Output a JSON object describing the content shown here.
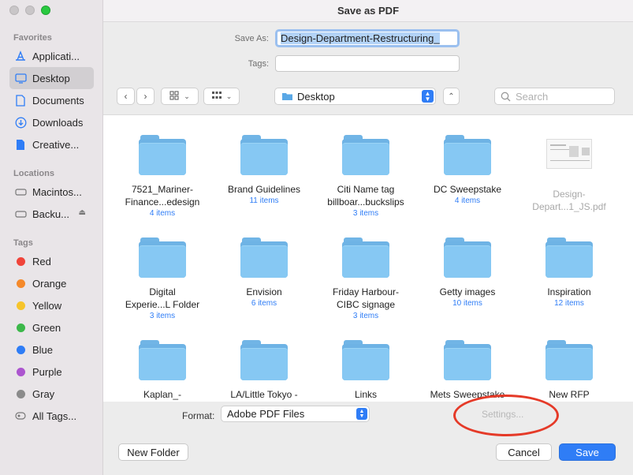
{
  "window": {
    "title": "Save as PDF"
  },
  "sidebar": {
    "favorites_header": "Favorites",
    "favorites": [
      {
        "label": "Applicati...",
        "icon": "applications-icon"
      },
      {
        "label": "Desktop",
        "icon": "desktop-icon"
      },
      {
        "label": "Documents",
        "icon": "document-icon"
      },
      {
        "label": "Downloads",
        "icon": "download-icon"
      },
      {
        "label": "Creative...",
        "icon": "file-icon"
      }
    ],
    "locations_header": "Locations",
    "locations": [
      {
        "label": "Macintos...",
        "icon": "disk-icon"
      },
      {
        "label": "Backu...",
        "icon": "disk-icon"
      }
    ],
    "tags_header": "Tags",
    "tags": [
      {
        "label": "Red",
        "color": "#f0443a"
      },
      {
        "label": "Orange",
        "color": "#f5892a"
      },
      {
        "label": "Yellow",
        "color": "#f6c42b"
      },
      {
        "label": "Green",
        "color": "#3cb84a"
      },
      {
        "label": "Blue",
        "color": "#2f7df6"
      },
      {
        "label": "Purple",
        "color": "#ac55cf"
      },
      {
        "label": "Gray",
        "color": "#8b8b8b"
      }
    ],
    "all_tags": "All Tags..."
  },
  "form": {
    "save_as_label": "Save As:",
    "save_as_value": "Design-Department-Restructuring_",
    "tags_label": "Tags:"
  },
  "toolbar": {
    "location": "Desktop",
    "search_placeholder": "Search"
  },
  "files": [
    {
      "name": "7521_Mariner-\nFinance...edesign",
      "count": "4 items",
      "type": "folder"
    },
    {
      "name": "Brand Guidelines",
      "count": "11 items",
      "type": "folder"
    },
    {
      "name": "Citi Name tag\nbillboar...buckslips",
      "count": "3 items",
      "type": "folder"
    },
    {
      "name": "DC Sweepstake",
      "count": "4 items",
      "type": "folder"
    },
    {
      "name": "Design-\nDepart...1_JS.pdf",
      "count": "",
      "type": "pdf"
    },
    {
      "name": "Digital\nExperie...L Folder",
      "count": "3 items",
      "type": "folder"
    },
    {
      "name": "Envision",
      "count": "6 items",
      "type": "folder"
    },
    {
      "name": "Friday Harbour-\nCIBC signage",
      "count": "3 items",
      "type": "folder"
    },
    {
      "name": "Getty images",
      "count": "10 items",
      "type": "folder"
    },
    {
      "name": "Inspiration",
      "count": "12 items",
      "type": "folder"
    },
    {
      "name": "Kaplan_-",
      "count": "",
      "type": "folder"
    },
    {
      "name": "LA/Little Tokyo -",
      "count": "",
      "type": "folder"
    },
    {
      "name": "Links",
      "count": "",
      "type": "folder"
    },
    {
      "name": "Mets Sweepstake",
      "count": "",
      "type": "folder"
    },
    {
      "name": "New RFP",
      "count": "",
      "type": "folder"
    }
  ],
  "format": {
    "label": "Format:",
    "value": "Adobe PDF Files",
    "settings_label": "Settings..."
  },
  "buttons": {
    "new_folder": "New Folder",
    "cancel": "Cancel",
    "save": "Save"
  }
}
